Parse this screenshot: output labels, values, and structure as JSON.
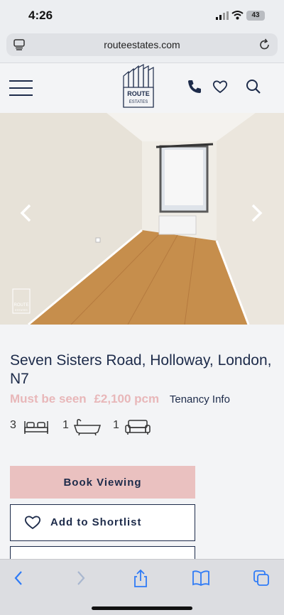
{
  "status": {
    "time": "4:26",
    "battery": "43"
  },
  "browser": {
    "url": "routeestates.com"
  },
  "header": {
    "logo_line1": "ROUTE",
    "logo_line2": "ESTATES"
  },
  "hero": {
    "watermark_line1": "ROUTE",
    "watermark_line2": "ESTATES"
  },
  "property": {
    "title": "Seven Sisters Road, Holloway, London, N7",
    "status": "Must be seen",
    "price": "£2,100 pcm",
    "tenancy_link": "Tenancy Info",
    "bedrooms": "3",
    "bathrooms": "1",
    "receptions": "1"
  },
  "actions": {
    "book_viewing": "Book Viewing",
    "add_to_shortlist": "Add to Shortlist"
  },
  "icons": {
    "header": [
      "menu-icon",
      "phone-icon",
      "heart-icon",
      "search-icon"
    ],
    "hero": [
      "chevron-left-icon",
      "chevron-right-icon"
    ],
    "features": [
      "bed-icon",
      "bath-icon",
      "sofa-icon"
    ],
    "toolbar": [
      "back-icon",
      "forward-icon",
      "share-icon",
      "bookmarks-icon",
      "tabs-icon"
    ]
  },
  "colors": {
    "navy": "#1d2b4a",
    "pink": "#eac1c0",
    "price_pink": "#e8b7b9",
    "ios_blue": "#2f7bf6"
  }
}
